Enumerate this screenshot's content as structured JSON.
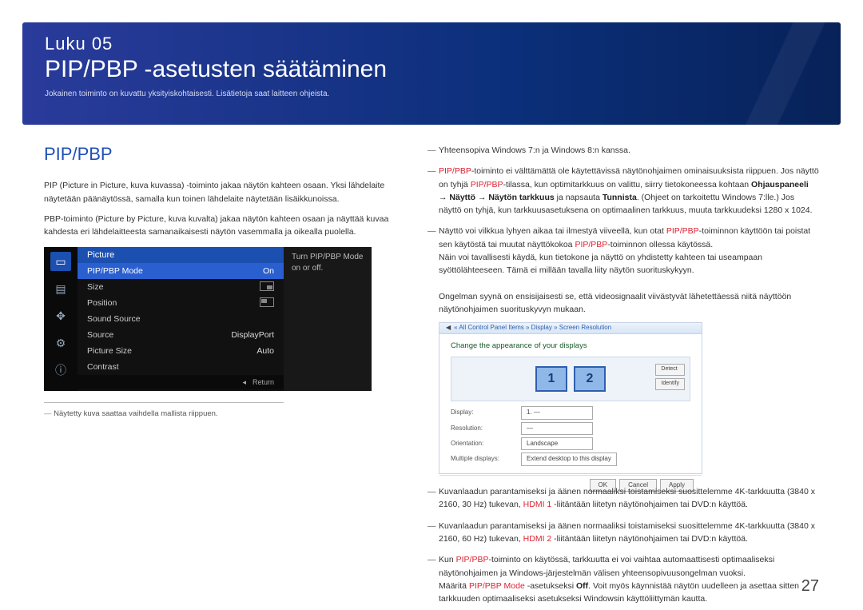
{
  "header": {
    "chapter_label": "Luku 05",
    "title": "PIP/PBP -asetusten säätäminen",
    "subtitle": "Jokainen toiminto on kuvattu yksityiskohtaisesti. Lisätietoja saat laitteen ohjeista."
  },
  "left": {
    "section_title": "PIP/PBP",
    "para1": "PIP (Picture in Picture, kuva kuvassa) -toiminto jakaa näytön kahteen osaan. Yksi lähdelaite näytetään päänäytössä, samalla kun toinen lähdelaite näytetään lisäikkunoissa.",
    "para2": "PBP-toiminto (Picture by Picture, kuva kuvalta) jakaa näytön kahteen osaan ja näyttää kuvaa kahdesta eri lähdelaitteesta samanaikaisesti näytön vasemmalla ja oikealla puolella.",
    "footnote": "Näytetty kuva saattaa vaihdella mallista riippuen."
  },
  "osd": {
    "head": "Picture",
    "side": "Turn PIP/PBP Mode on or off.",
    "rows": [
      {
        "label": "PIP/PBP Mode",
        "value": "On",
        "selected": true
      },
      {
        "label": "Size",
        "value": "",
        "icon": "a"
      },
      {
        "label": "Position",
        "value": "",
        "icon": "b"
      },
      {
        "label": "Sound Source",
        "value": ""
      },
      {
        "label": "Source",
        "value": "DisplayPort"
      },
      {
        "label": "Picture Size",
        "value": "Auto"
      },
      {
        "label": "Contrast",
        "value": ""
      }
    ],
    "return": "Return"
  },
  "right": {
    "note1": "Yhteensopiva Windows 7:n ja Windows 8:n kanssa.",
    "note2_a": "PIP/PBP",
    "note2_b": "-toiminto ei välttämättä ole käytettävissä näytönohjaimen ominaisuuksista riippuen. Jos näyttö on tyhjä ",
    "note2_c": "PIP/PBP",
    "note2_d": "-tilassa, kun optimitarkkuus on valittu, siirry tietokoneessa kohtaan ",
    "note2_e": "Ohjauspaneeli → Näyttö → Näytön tarkkuus",
    "note2_f": " ja napsauta ",
    "note2_g": "Tunnista",
    "note2_h": ". (Ohjeet on tarkoitettu Windows 7:lle.) Jos näyttö on tyhjä, kun tarkkuusasetuksena on optimaalinen tarkkuus, muuta tarkkuudeksi 1280 x 1024.",
    "note3_a": "Näyttö voi vilkkua lyhyen aikaa tai ilmestyä viiveellä, kun otat ",
    "note3_b": "PIP/PBP",
    "note3_c": "-toiminnon käyttöön tai poistat sen käytöstä tai muutat näyttökokoa ",
    "note3_d": "PIP/PBP",
    "note3_e": "-toiminnon ollessa käytössä.",
    "note3_f": "Näin voi tavallisesti käydä, kun tietokone ja näyttö on yhdistetty kahteen tai useampaan syöttölähteeseen. Tämä ei millään tavalla liity näytön suorituskykyyn.",
    "note3_g": "Ongelman syynä on ensisijaisesti se, että videosignaalit viivästyvät lähetettäessä niitä näyttöön näytönohjaimen suorituskyvyn mukaan.",
    "note4_a": "Kuvanlaadun parantamiseksi ja äänen normaaliksi toistamiseksi suosittelemme 4K-tarkkuutta (3840 x 2160, 30 Hz) tukevan, ",
    "note4_b": "HDMI 1",
    "note4_c": " -liitäntään liitetyn näytönohjaimen tai DVD:n käyttöä.",
    "note5_a": "Kuvanlaadun parantamiseksi ja äänen normaaliksi toistamiseksi suosittelemme 4K-tarkkuutta (3840 x 2160, 60 Hz) tukevan, ",
    "note5_b": "HDMI 2",
    "note5_c": " -liitäntään liitetyn näytönohjaimen tai DVD:n käyttöä.",
    "note6_a": "Kun ",
    "note6_b": "PIP/PBP",
    "note6_c": "-toiminto on käytössä, tarkkuutta ei voi vaihtaa automaattisesti optimaaliseksi näytönohjaimen ja Windows-järjestelmän välisen yhteensopivuusongelman vuoksi.",
    "note6_d": "Määritä ",
    "note6_e": "PIP/PBP Mode",
    "note6_f": " -asetukseksi ",
    "note6_g": "Off",
    "note6_h": ". Voit myös käynnistää näytön uudelleen ja asettaa sitten tarkkuuden optimaaliseksi asetukseksi Windowsin käyttöliittymän kautta."
  },
  "winshot": {
    "crumb": "« All Control Panel Items » Display » Screen Resolution",
    "title": "Change the appearance of your displays",
    "mon1": "1",
    "mon2": "2",
    "btn_detect": "Detect",
    "btn_identify": "Identify",
    "fields": {
      "display": "Display:",
      "display_val": "1. —",
      "resolution": "Resolution:",
      "resolution_val": "—",
      "orientation": "Orientation:",
      "orientation_val": "Landscape",
      "multiple": "Multiple displays:",
      "multiple_val": "Extend desktop to this display"
    },
    "foot_ok": "OK",
    "foot_cancel": "Cancel",
    "foot_apply": "Apply"
  },
  "page_number": "27"
}
